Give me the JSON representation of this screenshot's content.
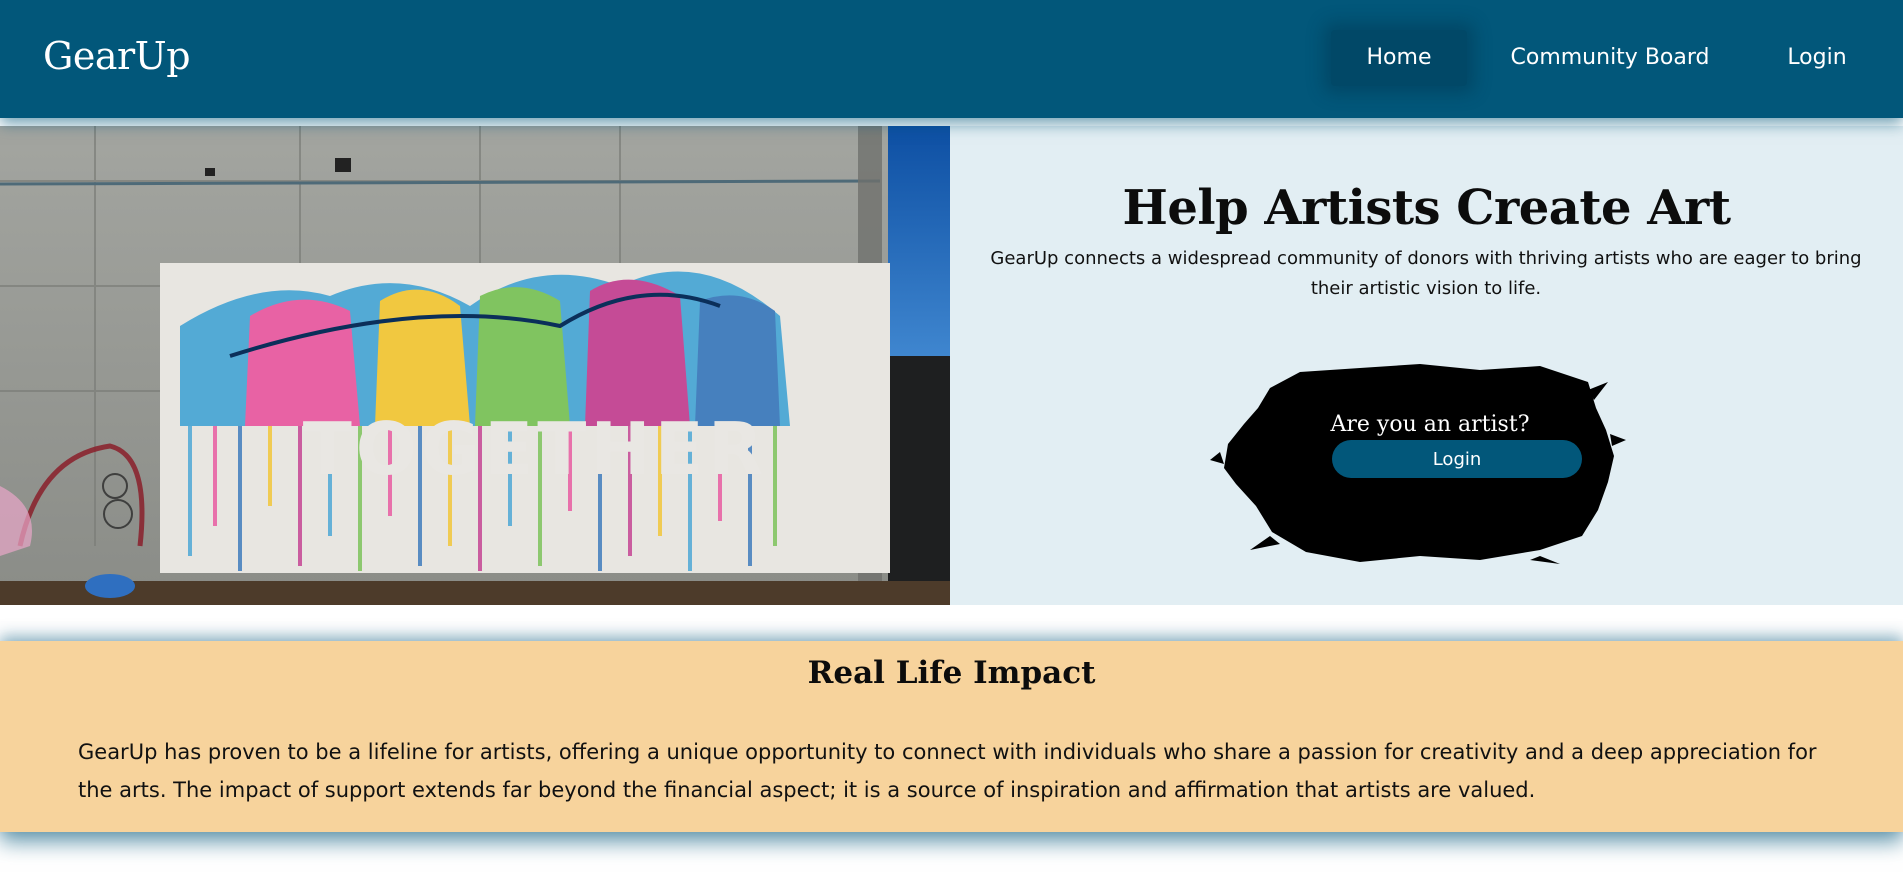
{
  "nav": {
    "brand": "GearUp",
    "links": [
      "Home",
      "Community Board",
      "Login"
    ],
    "active": "Home"
  },
  "hero": {
    "image_text": "TOGETHER",
    "title": "Help Artists Create Art",
    "description": "GearUp connects a widespread community of donors with thriving artists who are eager to bring their artistic vision to life.",
    "artist_prompt": "Are you an artist?",
    "artist_login_label": "Login"
  },
  "impact": {
    "title": "Real Life Impact",
    "text": "GearUp has proven to be a lifeline for artists, offering a unique opportunity to connect with individuals who share a passion for creativity and a deep appreciation for the arts. The impact of support extends far beyond the financial aspect; it is a source of inspiration and affirmation that artists are valued."
  },
  "colors": {
    "primary": "#02577a",
    "hero_bg": "#e2eef3",
    "impact_bg": "#f7d39c",
    "text": "#111111"
  }
}
